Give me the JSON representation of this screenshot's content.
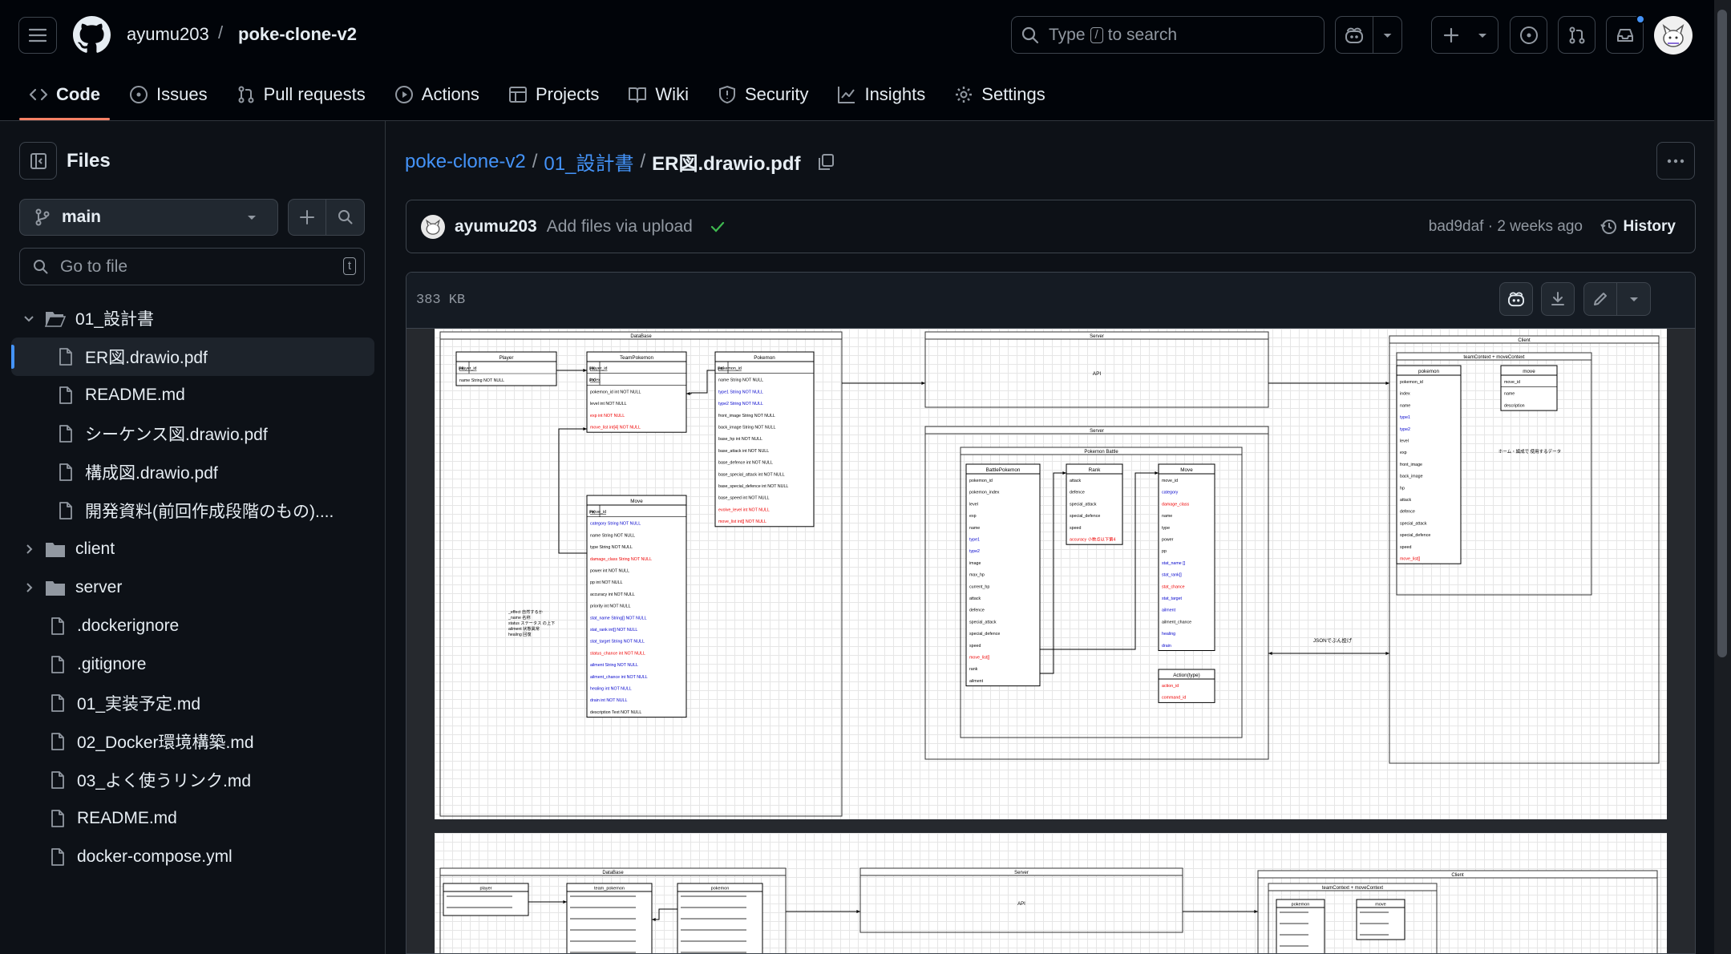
{
  "header": {
    "owner": "ayumu203",
    "separator": "/",
    "repo": "poke-clone-v2",
    "search_text_before": "Type",
    "search_key": "/",
    "search_text_after": "to search"
  },
  "nav": {
    "tabs": [
      {
        "label": "Code",
        "icon": "code-icon"
      },
      {
        "label": "Issues",
        "icon": "issue-icon"
      },
      {
        "label": "Pull requests",
        "icon": "pull-request-icon"
      },
      {
        "label": "Actions",
        "icon": "play-icon"
      },
      {
        "label": "Projects",
        "icon": "table-icon"
      },
      {
        "label": "Wiki",
        "icon": "book-icon"
      },
      {
        "label": "Security",
        "icon": "shield-icon"
      },
      {
        "label": "Insights",
        "icon": "graph-icon"
      },
      {
        "label": "Settings",
        "icon": "gear-icon"
      }
    ],
    "active": "Code"
  },
  "sidebar": {
    "title": "Files",
    "branch": "main",
    "goto_placeholder": "Go to file",
    "goto_key": "t",
    "tree": [
      {
        "label": "01_設計書",
        "type": "folder-open"
      },
      {
        "label": "ER図.drawio.pdf",
        "type": "file",
        "selected": true
      },
      {
        "label": "README.md",
        "type": "file"
      },
      {
        "label": "シーケンス図.drawio.pdf",
        "type": "file"
      },
      {
        "label": "構成図.drawio.pdf",
        "type": "file"
      },
      {
        "label": "開発資料(前回作成段階のもの)....",
        "type": "file"
      },
      {
        "label": "client",
        "type": "folder"
      },
      {
        "label": "server",
        "type": "folder"
      },
      {
        "label": ".dockerignore",
        "type": "root-file"
      },
      {
        "label": ".gitignore",
        "type": "root-file"
      },
      {
        "label": "01_実装予定.md",
        "type": "root-file"
      },
      {
        "label": "02_Docker環境構築.md",
        "type": "root-file"
      },
      {
        "label": "03_よく使うリンク.md",
        "type": "root-file"
      },
      {
        "label": "README.md",
        "type": "root-file"
      },
      {
        "label": "docker-compose.yml",
        "type": "root-file"
      }
    ]
  },
  "breadcrumb": {
    "repo": "poke-clone-v2",
    "folder": "01_設計書",
    "file": "ER図.drawio.pdf",
    "sep": "/"
  },
  "commit": {
    "author": "ayumu203",
    "message": "Add files via upload",
    "sha_time": "bad9daf · 2 weeks ago",
    "history": "History"
  },
  "file": {
    "size": "383 KB"
  },
  "er_page1": {
    "database_title": "DataBase",
    "player": {
      "title": "Player",
      "rows": [
        "player_id",
        "name String NOT NULL"
      ]
    },
    "team": {
      "title": "TeamPokemon",
      "rows": [
        "player_id",
        "index",
        "pokemon_id int NOT NULL",
        "level int NOT NULL",
        "exp int NOT NULL",
        "move_list int[4] NOT NULL"
      ]
    },
    "pokemon": {
      "title": "Pokemon",
      "rows": [
        "pokemon_id",
        "name String NOT NULL",
        "type1 String NOT NULL",
        "type2 String NOT NULL",
        "front_image String NOT NULL",
        "back_image String NOT NULL",
        "base_hp int NOT NULL",
        "base_attack int NOT NULL",
        "base_defence int NOT NULL",
        "base_special_attack int NOT NULL",
        "base_special_defence int NOT NULL",
        "base_speed int NOT NULL",
        "evolve_level int NOT NULL",
        "move_list int[] NOT NULL"
      ]
    },
    "move": {
      "title": "Move",
      "rows": [
        "move_id",
        "category String NOT NULL",
        "name String NOT NULL",
        "type String NOT NULL",
        "damage_class String NOT NULL",
        "power int NOT NULL",
        "pp int NOT NULL",
        "accuracy int NOT NULL",
        "priority int NOT NULL",
        "stat_name String[] NOT NULL",
        "stat_rank int[] NOT NULL",
        "stat_target String NOT NULL",
        "status_chance int NOT NULL",
        "ailment String NOT NULL",
        "ailment_chance int NOT NULL",
        "healing int NOT NULL",
        "drain int NOT NULL",
        "description Text NOT NULL"
      ]
    },
    "note": [
      "_effect 自然するか",
      "_name 名称",
      "status ステータス の上下",
      "ailment 状態異常",
      "healing 回復"
    ],
    "server_top": "Server",
    "api": "API",
    "server_bottom": "Server",
    "battle_title": "Pokemon Battle",
    "battle_pokemon": {
      "title": "BattlePokemon",
      "rows": [
        "pokemon_id",
        "pokemon_index",
        "level",
        "exp",
        "name",
        "type1",
        "type2",
        "image",
        "max_hp",
        "current_hp",
        "attack",
        "defence",
        "special_attack",
        "special_defence",
        "speed",
        "move_list[]",
        "rank",
        "ailment"
      ]
    },
    "rank": {
      "title": "Rank",
      "rows": [
        "attack",
        "defence",
        "special_attack",
        "special_defence",
        "speed",
        "accuracy 小数点以下第4"
      ]
    },
    "move_s": {
      "title": "Move",
      "rows": [
        "move_id",
        "category",
        "damage_class",
        "name",
        "type",
        "power",
        "pp",
        "stat_name []",
        "stat_rank[]",
        "stat_chance",
        "stat_target",
        "ailment",
        "ailment_chance",
        "healing",
        "drain"
      ]
    },
    "action": {
      "title": "Action(type)",
      "rows": [
        "action_id",
        "command_id"
      ]
    },
    "json_label": "JSONでぶん投げ",
    "client_title": "Client",
    "context_title": "teamContext + moveContext",
    "client_pokemon": {
      "title": "pokemon",
      "rows": [
        "pokemon_id",
        "index",
        "name",
        "type1",
        "type2",
        "level",
        "exp",
        "front_image",
        "back_image",
        "hp",
        "attack",
        "defence",
        "special_attack",
        "special_defence",
        "speed",
        "move_list[]"
      ]
    },
    "client_move": {
      "title": "move",
      "rows": [
        "move_id",
        "name",
        "description"
      ]
    },
    "client_note": "ホーム・編成で 使用するデータ"
  },
  "er_page2": {
    "database_title": "DataBase",
    "player_title": "player",
    "team_title": "team_pokemon",
    "pokemon_title": "pokemon",
    "server_title": "Server",
    "api": "API",
    "client_title": "Client",
    "context_title": "teamContext + moveContext",
    "pokemon_c_title": "pokemon",
    "move_c_title": "move"
  }
}
